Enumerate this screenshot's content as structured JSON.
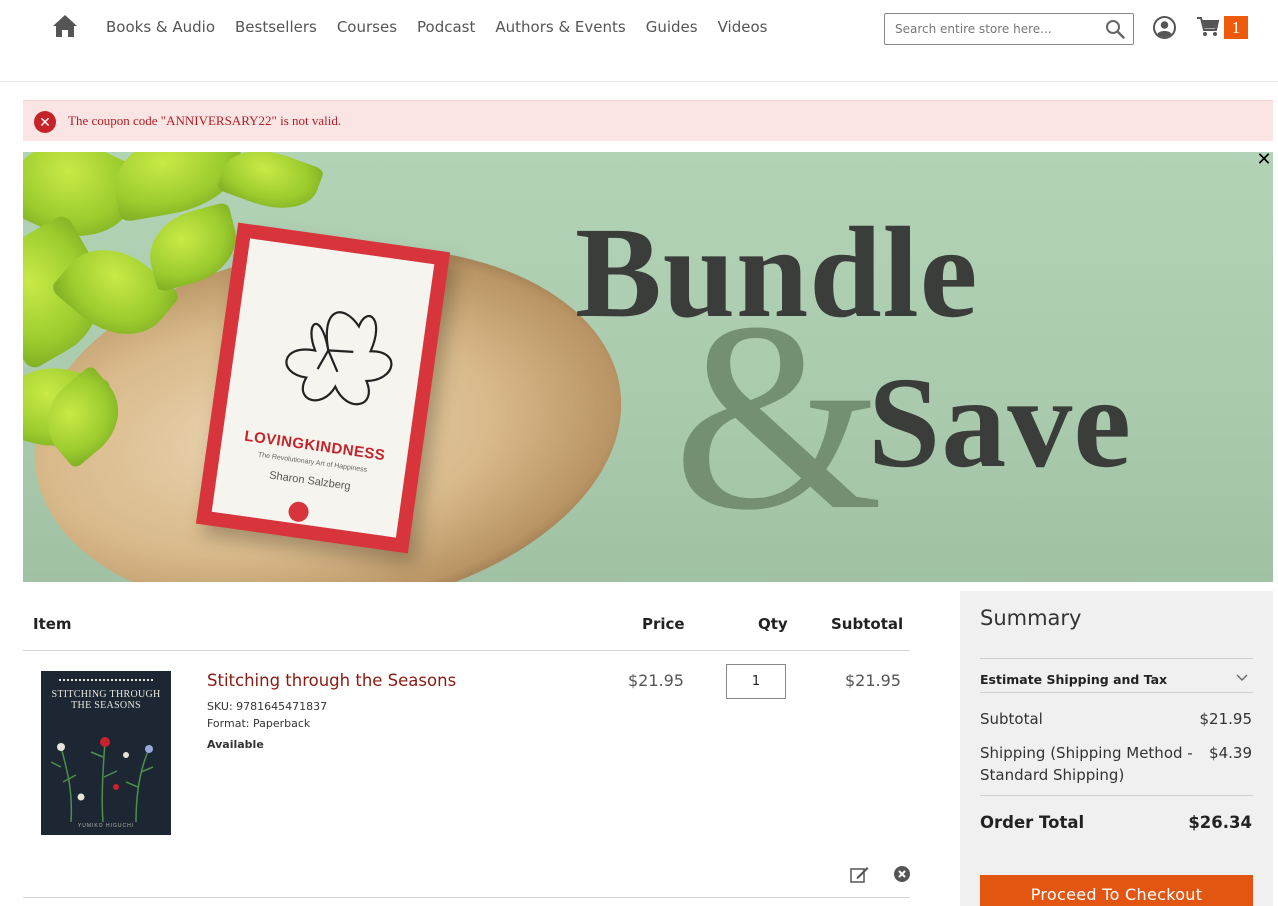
{
  "header": {
    "nav": [
      "Books & Audio",
      "Bestsellers",
      "Courses",
      "Podcast",
      "Authors & Events",
      "Guides",
      "Videos"
    ],
    "search_placeholder": "Search entire store here...",
    "cart_count": "1"
  },
  "alert": {
    "message": "The coupon code \"ANNIVERSARY22\" is not valid."
  },
  "banner": {
    "word1": "Bundle",
    "amp": "&",
    "word2": "Save",
    "book": {
      "title": "LOVINGKINDNESS",
      "subtitle": "The Revolutionary Art of Happiness",
      "author": "Sharon Salzberg"
    }
  },
  "cart": {
    "headers": {
      "item": "Item",
      "price": "Price",
      "qty": "Qty",
      "subtotal": "Subtotal"
    },
    "items": [
      {
        "name": "Stitching through the Seasons",
        "sku": "SKU: 9781645471837",
        "format": "Format: Paperback",
        "availability": "Available",
        "price": "$21.95",
        "qty": "1",
        "subtotal": "$21.95",
        "cover_title": "STITCHING THROUGH THE SEASONS",
        "cover_author": "YUMIKO HIGUCHI"
      }
    ]
  },
  "summary": {
    "title": "Summary",
    "estimate": "Estimate Shipping and Tax",
    "subtotal_label": "Subtotal",
    "subtotal_value": "$21.95",
    "shipping_label": "Shipping (Shipping Method - Standard Shipping)",
    "shipping_value": "$4.39",
    "total_label": "Order Total",
    "total_value": "$26.34",
    "checkout_label": "Proceed To Checkout"
  },
  "colors": {
    "accent": "#e25612",
    "error_bg": "#fbe4e4",
    "error_text": "#b21e23",
    "product_link": "#8b1a10"
  }
}
